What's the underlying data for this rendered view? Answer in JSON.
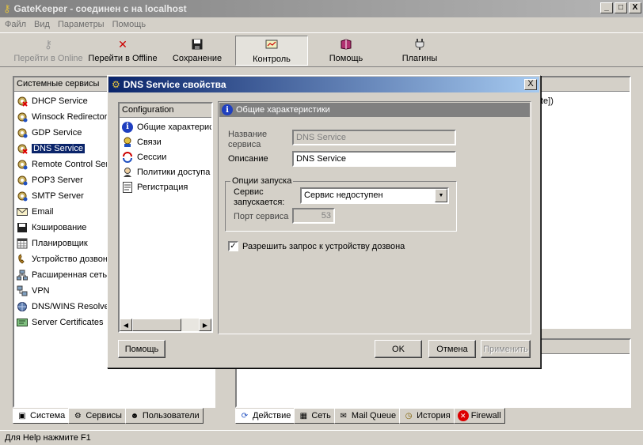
{
  "app": {
    "title": "GateKeeper - соединен с на localhost",
    "window_buttons": [
      "_",
      "□",
      "X"
    ]
  },
  "menu": [
    "Файл",
    "Вид",
    "Параметры",
    "Помощь"
  ],
  "toolbar": {
    "online": "Перейти в Online",
    "offline": "Перейти в Offline",
    "save": "Сохранение",
    "control": "Контроль",
    "help": "Помощь",
    "plugins": "Плагины"
  },
  "left_panel": {
    "header": "Системные сервисы",
    "items": [
      {
        "label": "DHCP Service",
        "icon": "gear-disabled-icon"
      },
      {
        "label": "Winsock Redirector",
        "icon": "gear-icon"
      },
      {
        "label": "GDP Service",
        "icon": "gear-icon"
      },
      {
        "label": "DNS Service",
        "icon": "gear-disabled-icon",
        "selected": true
      },
      {
        "label": "Remote Control Server",
        "icon": "gear-icon"
      },
      {
        "label": "POP3 Server",
        "icon": "gear-icon"
      },
      {
        "label": "SMTP Server",
        "icon": "gear-icon"
      },
      {
        "label": "Email",
        "icon": "envelope-icon"
      },
      {
        "label": "Кэширование",
        "icon": "cache-icon"
      },
      {
        "label": "Планировщик",
        "icon": "calendar-icon"
      },
      {
        "label": "Устройство дозвона",
        "icon": "modem-icon"
      },
      {
        "label": "Расширенная сеть",
        "icon": "network-icon"
      },
      {
        "label": "VPN",
        "icon": "vpn-icon"
      },
      {
        "label": "DNS/WINS Resolver",
        "icon": "resolver-icon"
      },
      {
        "label": "Server Certificates",
        "icon": "certificate-icon"
      }
    ],
    "tabs": [
      "Система",
      "Сервисы",
      "Пользователи"
    ]
  },
  "right_panel": {
    "visible_text": "te])",
    "tabs": [
      "Действие",
      "Сеть",
      "Mail Queue",
      "История",
      "Firewall"
    ]
  },
  "status": "Для Help нажмите F1",
  "dialog": {
    "title": "DNS Service свойства",
    "close": "X",
    "config_header": "Configuration",
    "config_items": [
      {
        "label": "Общие характеристики",
        "icon": "info-icon"
      },
      {
        "label": "Связи",
        "icon": "bindings-icon"
      },
      {
        "label": "Сессии",
        "icon": "sessions-icon"
      },
      {
        "label": "Политики доступа",
        "icon": "policy-icon"
      },
      {
        "label": "Регистрация",
        "icon": "log-icon"
      }
    ],
    "section_title": "Общие характеристики",
    "name_label_1": "Название",
    "name_label_2": "сервиса",
    "name_value": "DNS Service",
    "desc_label": "Описание",
    "desc_value": "DNS Service",
    "group_title": "Опции запуска",
    "start_label_1": "Сервис",
    "start_label_2": "запускается:",
    "start_value": "Сервис недоступен",
    "port_label": "Порт сервиса",
    "port_value": "53",
    "dial_checkbox": "Разрешить запрос к устройству дозвона",
    "dial_checked": true,
    "buttons": {
      "help": "Помощь",
      "ok": "OK",
      "cancel": "Отмена",
      "apply": "Применить"
    }
  }
}
